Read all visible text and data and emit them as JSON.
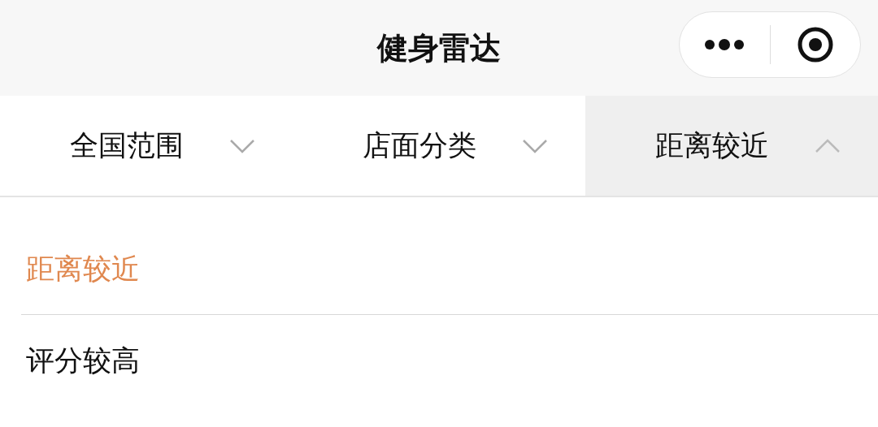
{
  "window": {
    "title": "健身雷达"
  },
  "filters": [
    {
      "label": "全国范围",
      "selected": false
    },
    {
      "label": "店面分类",
      "selected": false
    },
    {
      "label": "距离较近",
      "selected": true
    }
  ],
  "sort_options": [
    {
      "label": "距离较近",
      "selected": true
    },
    {
      "label": "评分较高",
      "selected": false
    }
  ]
}
